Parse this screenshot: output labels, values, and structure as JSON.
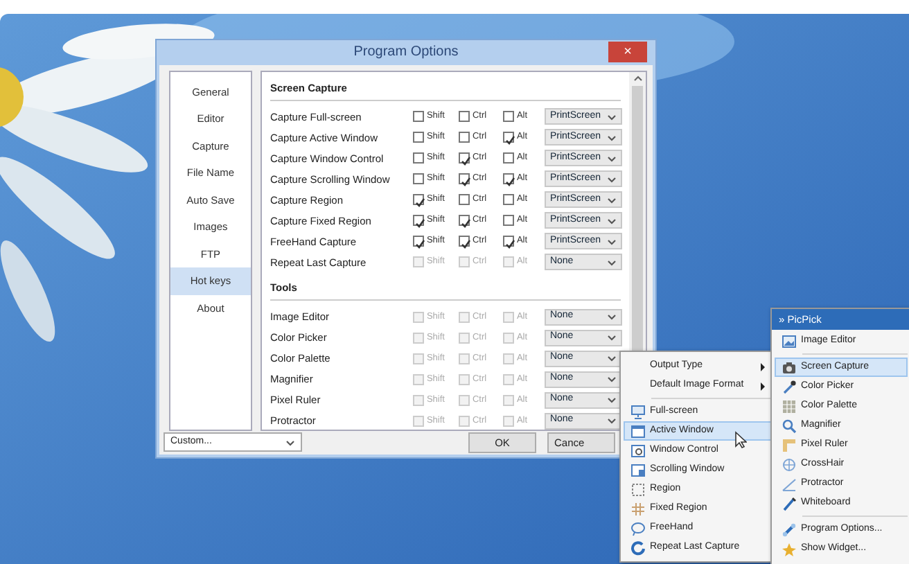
{
  "dialog": {
    "title": "Program Options",
    "close": "×",
    "nav": [
      {
        "label": "General",
        "selected": false
      },
      {
        "label": "Editor",
        "selected": false
      },
      {
        "label": "Capture",
        "selected": false
      },
      {
        "label": "File Name",
        "selected": false
      },
      {
        "label": "Auto Save",
        "selected": false
      },
      {
        "label": "Images",
        "selected": false
      },
      {
        "label": "FTP",
        "selected": false
      },
      {
        "label": "Hot keys",
        "selected": true
      },
      {
        "label": "About",
        "selected": false
      }
    ],
    "sections": [
      {
        "title": "Screen Capture",
        "rows": [
          {
            "label": "Capture Full-screen",
            "disabled": false,
            "modifiers": [
              {
                "label": "Shift",
                "checked": false
              },
              {
                "label": "Ctrl",
                "checked": false
              },
              {
                "label": "Alt",
                "checked": false
              }
            ],
            "key": "PrintScreen"
          },
          {
            "label": "Capture Active Window",
            "disabled": false,
            "modifiers": [
              {
                "label": "Shift",
                "checked": false
              },
              {
                "label": "Ctrl",
                "checked": false
              },
              {
                "label": "Alt",
                "checked": true
              }
            ],
            "key": "PrintScreen"
          },
          {
            "label": "Capture Window Control",
            "disabled": false,
            "modifiers": [
              {
                "label": "Shift",
                "checked": false
              },
              {
                "label": "Ctrl",
                "checked": true
              },
              {
                "label": "Alt",
                "checked": false
              }
            ],
            "key": "PrintScreen"
          },
          {
            "label": "Capture Scrolling Window",
            "disabled": false,
            "modifiers": [
              {
                "label": "Shift",
                "checked": false
              },
              {
                "label": "Ctrl",
                "checked": true
              },
              {
                "label": "Alt",
                "checked": true
              }
            ],
            "key": "PrintScreen"
          },
          {
            "label": "Capture Region",
            "disabled": false,
            "modifiers": [
              {
                "label": "Shift",
                "checked": true
              },
              {
                "label": "Ctrl",
                "checked": false
              },
              {
                "label": "Alt",
                "checked": false
              }
            ],
            "key": "PrintScreen"
          },
          {
            "label": "Capture Fixed Region",
            "disabled": false,
            "modifiers": [
              {
                "label": "Shift",
                "checked": true
              },
              {
                "label": "Ctrl",
                "checked": true
              },
              {
                "label": "Alt",
                "checked": false
              }
            ],
            "key": "PrintScreen"
          },
          {
            "label": "FreeHand Capture",
            "disabled": false,
            "modifiers": [
              {
                "label": "Shift",
                "checked": true
              },
              {
                "label": "Ctrl",
                "checked": true
              },
              {
                "label": "Alt",
                "checked": true
              }
            ],
            "key": "PrintScreen"
          },
          {
            "label": "Repeat Last Capture",
            "disabled": true,
            "modifiers": [
              {
                "label": "Shift",
                "checked": false
              },
              {
                "label": "Ctrl",
                "checked": false
              },
              {
                "label": "Alt",
                "checked": false
              }
            ],
            "key": "None"
          }
        ]
      },
      {
        "title": "Tools",
        "rows": [
          {
            "label": "Image Editor",
            "disabled": true,
            "modifiers": [
              {
                "label": "Shift",
                "checked": false
              },
              {
                "label": "Ctrl",
                "checked": false
              },
              {
                "label": "Alt",
                "checked": false
              }
            ],
            "key": "None"
          },
          {
            "label": "Color Picker",
            "disabled": true,
            "modifiers": [
              {
                "label": "Shift",
                "checked": false
              },
              {
                "label": "Ctrl",
                "checked": false
              },
              {
                "label": "Alt",
                "checked": false
              }
            ],
            "key": "None"
          },
          {
            "label": "Color Palette",
            "disabled": true,
            "modifiers": [
              {
                "label": "Shift",
                "checked": false
              },
              {
                "label": "Ctrl",
                "checked": false
              },
              {
                "label": "Alt",
                "checked": false
              }
            ],
            "key": "None"
          },
          {
            "label": "Magnifier",
            "disabled": true,
            "modifiers": [
              {
                "label": "Shift",
                "checked": false
              },
              {
                "label": "Ctrl",
                "checked": false
              },
              {
                "label": "Alt",
                "checked": false
              }
            ],
            "key": "None"
          },
          {
            "label": "Pixel Ruler",
            "disabled": true,
            "modifiers": [
              {
                "label": "Shift",
                "checked": false
              },
              {
                "label": "Ctrl",
                "checked": false
              },
              {
                "label": "Alt",
                "checked": false
              }
            ],
            "key": "None"
          },
          {
            "label": "Protractor",
            "disabled": true,
            "modifiers": [
              {
                "label": "Shift",
                "checked": false
              },
              {
                "label": "Ctrl",
                "checked": false
              },
              {
                "label": "Alt",
                "checked": false
              }
            ],
            "key": "None"
          }
        ]
      }
    ],
    "profile": "Custom...",
    "buttons": [
      "OK",
      "Cance"
    ]
  },
  "context_menu": {
    "items": [
      {
        "kind": "submenu",
        "label": "Output Type"
      },
      {
        "kind": "submenu",
        "label": "Default Image Format"
      },
      {
        "kind": "separator"
      },
      {
        "kind": "item",
        "label": "Full-screen",
        "selected": false
      },
      {
        "kind": "item",
        "label": "Active Window",
        "selected": true
      },
      {
        "kind": "item",
        "label": "Window Control",
        "selected": false
      },
      {
        "kind": "item",
        "label": "Scrolling Window",
        "selected": false
      },
      {
        "kind": "item",
        "label": "Region",
        "selected": false
      },
      {
        "kind": "item",
        "label": "Fixed Region",
        "selected": false
      },
      {
        "kind": "item",
        "label": "FreeHand",
        "selected": false
      },
      {
        "kind": "item",
        "label": "Repeat Last Capture",
        "selected": false
      }
    ]
  },
  "tray_menu": {
    "title": "» PicPick",
    "items": [
      {
        "kind": "item",
        "label": "Image Editor",
        "selected": false
      },
      {
        "kind": "separator"
      },
      {
        "kind": "item",
        "label": "Screen Capture",
        "selected": true
      },
      {
        "kind": "item",
        "label": "Color Picker",
        "selected": false
      },
      {
        "kind": "item",
        "label": "Color Palette",
        "selected": false
      },
      {
        "kind": "item",
        "label": "Magnifier",
        "selected": false
      },
      {
        "kind": "item",
        "label": "Pixel Ruler",
        "selected": false
      },
      {
        "kind": "item",
        "label": "CrossHair",
        "selected": false
      },
      {
        "kind": "item",
        "label": "Protractor",
        "selected": false
      },
      {
        "kind": "item",
        "label": "Whiteboard",
        "selected": false
      },
      {
        "kind": "separator"
      },
      {
        "kind": "item",
        "label": "Program Options...",
        "selected": false
      },
      {
        "kind": "item",
        "label": "Show Widget...",
        "selected": false
      }
    ]
  }
}
